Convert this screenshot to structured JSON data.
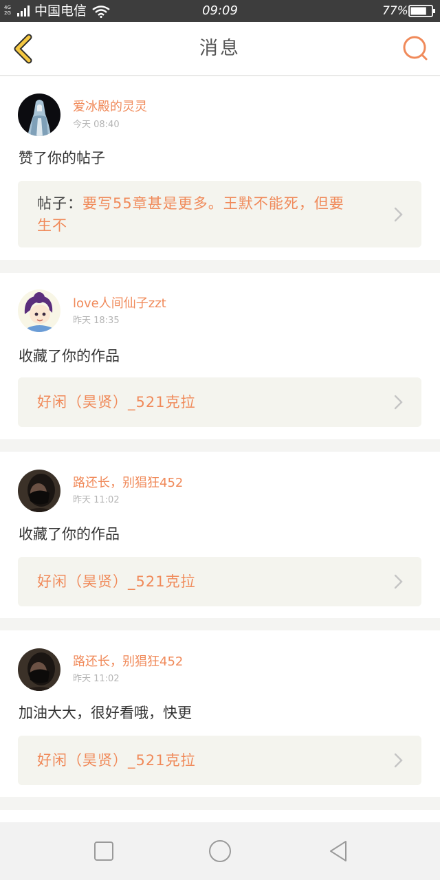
{
  "status_bar": {
    "network_top": "4G",
    "network_bottom": "2G",
    "carrier": "中国电信",
    "time": "09:09",
    "battery_percent": "77%",
    "battery_level": 0.77
  },
  "header": {
    "title": "消息"
  },
  "messages": [
    {
      "username": "爱冰殿的灵灵",
      "time": "今天 08:40",
      "action": "赞了你的帖子",
      "ref_prefix": "帖子：",
      "ref_line1": "要写55章甚是更多。王默不能死，但要",
      "ref_line2": "生不"
    },
    {
      "username": "love人间仙子zzt",
      "time": "昨天 18:35",
      "action": "收藏了你的作品",
      "ref_title": "好闲（昊贤）_521克拉"
    },
    {
      "username": "路还长，别猖狂452",
      "time": "昨天 11:02",
      "action": "收藏了你的作品",
      "ref_title": "好闲（昊贤）_521克拉"
    },
    {
      "username": "路还长，别猖狂452",
      "time": "昨天 11:02",
      "action": "加油大大，很好看哦，快更",
      "ref_title": "好闲（昊贤）_521克拉"
    }
  ],
  "nav_bar": {
    "recent_icon": "square-icon",
    "home_icon": "circle-icon",
    "back_icon": "triangle-back-icon"
  },
  "colors": {
    "accent": "#f08a5a",
    "back_arrow": "#f5c842",
    "card_background": "#ffffff",
    "reference_background": "#f4f4ee",
    "page_background": "#f4f4f2"
  }
}
